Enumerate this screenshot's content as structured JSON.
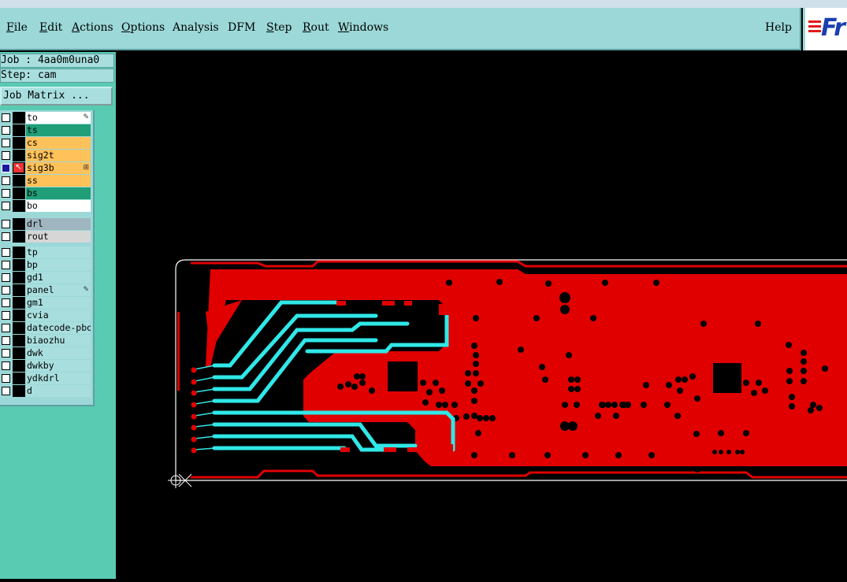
{
  "menu": {
    "file": "File",
    "edit": "Edit",
    "actions": "Actions",
    "options": "Options",
    "analysis": "Analysis",
    "dfm": "DFM",
    "step": "Step",
    "rout": "Rout",
    "windows": "Windows",
    "help": "Help"
  },
  "logo": {
    "text": "Fr"
  },
  "info": {
    "job": "Job : 4aa0m0una0",
    "step": "Step: cam"
  },
  "job_matrix": "Job Matrix ...",
  "layers": {
    "board": [
      {
        "name": "to",
        "color": "#ffffff"
      },
      {
        "name": "ts",
        "color": "#1f9e78"
      },
      {
        "name": "cs",
        "color": "#ffc15a"
      },
      {
        "name": "sig2t",
        "color": "#ffc15a"
      },
      {
        "name": "sig3b",
        "color": "#ffc15a"
      },
      {
        "name": "ss",
        "color": "#ffc15a"
      },
      {
        "name": "bs",
        "color": "#1f9e78"
      },
      {
        "name": "bo",
        "color": "#ffffff"
      }
    ],
    "drill": [
      {
        "name": "drl",
        "color": "#9fb5c0"
      },
      {
        "name": "rout",
        "color": "#d6d6d6"
      }
    ],
    "misc": [
      {
        "name": "tp",
        "color": "#a8dede"
      },
      {
        "name": "bp",
        "color": "#a8dede"
      },
      {
        "name": "gd1",
        "color": "#a8dede"
      },
      {
        "name": "panel",
        "color": "#a8dede"
      },
      {
        "name": "gm1",
        "color": "#a8dede"
      },
      {
        "name": "cvia",
        "color": "#a8dede"
      },
      {
        "name": "datecode-pbo",
        "color": "#a8dede"
      },
      {
        "name": "biaozhu",
        "color": "#a8dede"
      },
      {
        "name": "dwk",
        "color": "#a8dede"
      },
      {
        "name": "dwkby",
        "color": "#a8dede"
      },
      {
        "name": "ydkdrl",
        "color": "#a8dede"
      },
      {
        "name": "d",
        "color": "#a8dede"
      }
    ]
  },
  "colors": {
    "copper": "#e00000",
    "trace": "#30e8e8",
    "outline": "#ffffff",
    "background": "#000000"
  }
}
